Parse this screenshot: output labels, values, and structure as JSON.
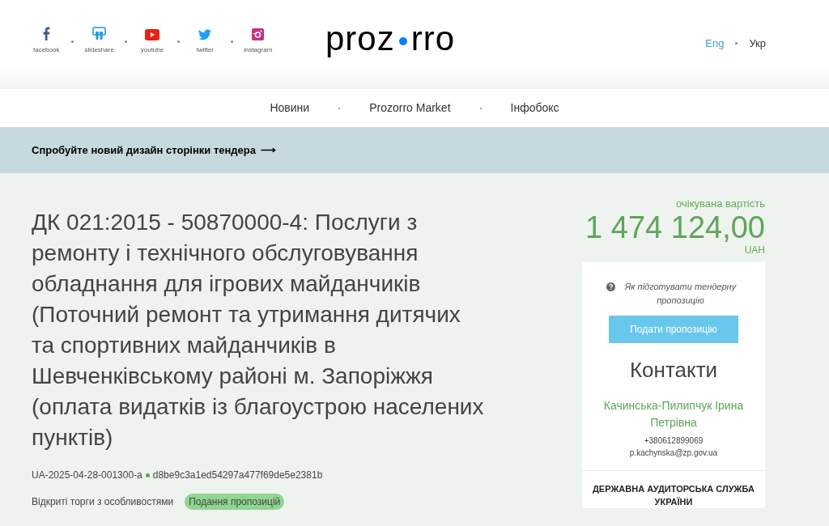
{
  "social": [
    {
      "kind": "facebook",
      "label": "facebook"
    },
    {
      "kind": "slideshare",
      "label": "slideshare"
    },
    {
      "kind": "youtube",
      "label": "youtube"
    },
    {
      "kind": "twitter",
      "label": "twitter"
    },
    {
      "kind": "instagram",
      "label": "instagram"
    }
  ],
  "logo": {
    "before": "proz",
    "after": "rro"
  },
  "languages": [
    {
      "label": "Eng",
      "selected": false
    },
    {
      "label": "Укр",
      "selected": true
    }
  ],
  "nav": [
    "Новини",
    "Prozorro Market",
    "Інфобокс"
  ],
  "banner": {
    "text": "Спробуйте новий дизайн сторінки тендера",
    "arrow": "⟶"
  },
  "tender": {
    "title": "ДК 021:2015 - 50870000-4: Послуги з ремонту і технічного обслуговування обладнання для ігрових майданчиків (Поточний ремонт та утримання дитячих та спортивних майданчиків в Шевченківському районі м. Запоріжжя (оплата видатків із благоустрою населених пунктів)",
    "id": "UA-2025-04-28-001300-a",
    "hash": "d8be9c3a1ed54297a477f69de5e2381b",
    "procedure": "Відкриті торги з особливостями",
    "status": "Подання пропозицій"
  },
  "price": {
    "label": "очікувана вартість",
    "amount": "1 474 124,00",
    "currency": "UAH"
  },
  "card": {
    "help_link": "Як підготувати тендерну пропозицію",
    "submit_button": "Подати пропозицію",
    "contacts_title": "Контакти",
    "contact_name": "Качинська-Пилипчук Ірина Петрівна",
    "phone": "+380612899069",
    "email": "p.kachynska@zp.gov.ua",
    "organization": "ДЕРЖАВНА АУДИТОРСЬКА СЛУЖБА УКРАЇНИ"
  }
}
